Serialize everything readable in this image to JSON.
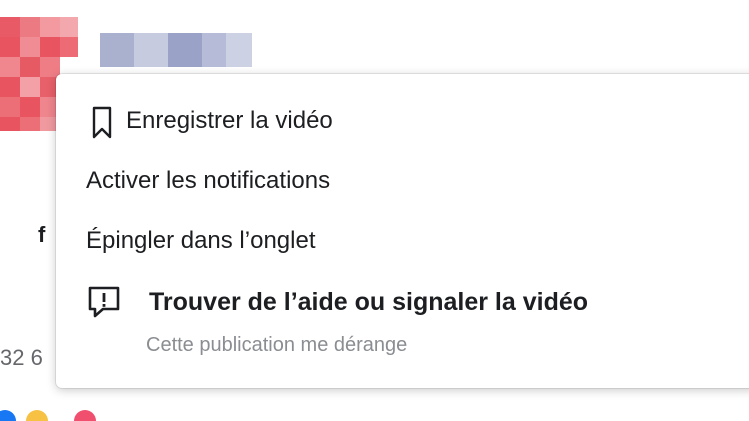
{
  "menu": {
    "items": [
      {
        "label": "Enregistrer la vidéo",
        "icon": "bookmark-icon"
      },
      {
        "label": "Activer les notifications"
      },
      {
        "label": "Épingler dans l’onglet"
      },
      {
        "label": "Trouver de l’aide ou signaler la vidéo",
        "sublabel": "Cette publication me dérange",
        "icon": "report-icon"
      }
    ]
  },
  "background": {
    "partial_name_letter": "f",
    "partial_count": "32 6"
  },
  "colors": {
    "text_primary": "#1c1e21",
    "text_secondary": "#8a8d91",
    "avatar_redacted": "#e8545f",
    "name_redacted": "#9aa3c7",
    "reaction_blue": "#1877f2",
    "reaction_yellow": "#f7c244",
    "reaction_red": "#f0506e"
  }
}
